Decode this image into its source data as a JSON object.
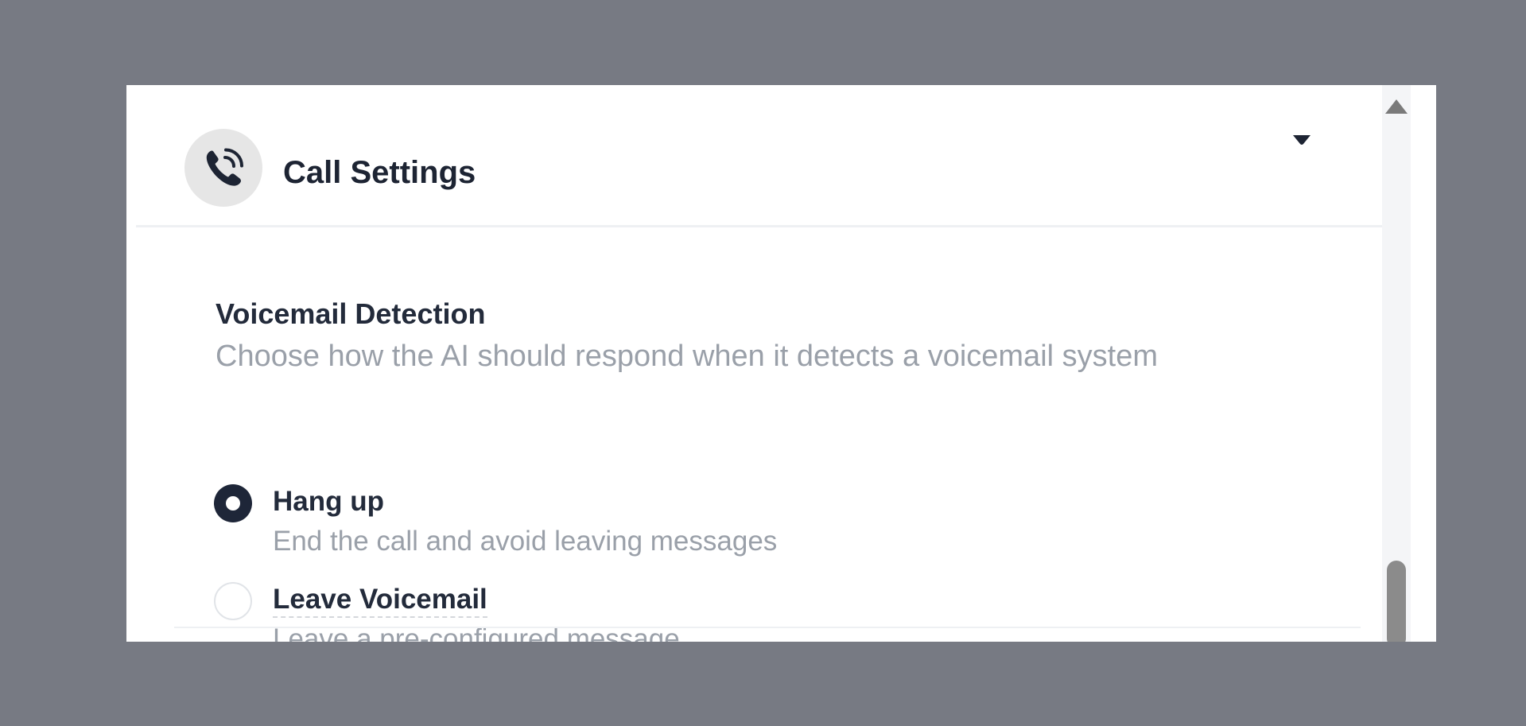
{
  "header": {
    "title": "Call Settings",
    "icon": "phone-call-icon",
    "toggle_icon": "caret-down-icon"
  },
  "voicemail": {
    "title": "Voicemail Detection",
    "description": "Choose how the AI should respond when it detects a voicemail system",
    "options": [
      {
        "label": "Hang up",
        "description": "End the call and avoid leaving messages",
        "selected": true
      },
      {
        "label": "Leave Voicemail",
        "description": "Leave a pre-configured message",
        "selected": false
      }
    ]
  },
  "scrollbar": {
    "up_icon": "scroll-up-arrow-icon"
  },
  "colors": {
    "backdrop": "#777a83",
    "panel": "#ffffff",
    "heading_text": "#1d2433",
    "muted_text": "#9aa0a9",
    "radio_checked": "#1e2638",
    "icon_bg": "#e6e6e6",
    "scroll_thumb": "#8b8b8b"
  }
}
